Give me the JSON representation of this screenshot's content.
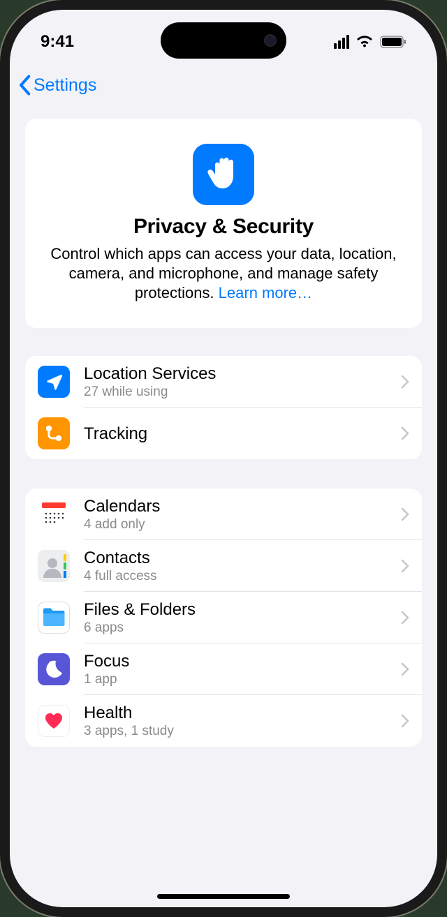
{
  "status": {
    "time": "9:41"
  },
  "nav": {
    "back_label": "Settings"
  },
  "hero": {
    "title": "Privacy & Security",
    "description": "Control which apps can access your data, location, camera, and microphone, and manage safety protections. ",
    "link": "Learn more…"
  },
  "groups": [
    {
      "rows": [
        {
          "icon": "location",
          "title": "Location Services",
          "sub": "27 while using"
        },
        {
          "icon": "tracking",
          "title": "Tracking",
          "sub": ""
        }
      ]
    },
    {
      "rows": [
        {
          "icon": "calendars",
          "title": "Calendars",
          "sub": "4 add only"
        },
        {
          "icon": "contacts",
          "title": "Contacts",
          "sub": "4 full access"
        },
        {
          "icon": "files",
          "title": "Files & Folders",
          "sub": "6 apps"
        },
        {
          "icon": "focus",
          "title": "Focus",
          "sub": "1 app"
        },
        {
          "icon": "health",
          "title": "Health",
          "sub": "3 apps, 1 study"
        }
      ]
    }
  ]
}
